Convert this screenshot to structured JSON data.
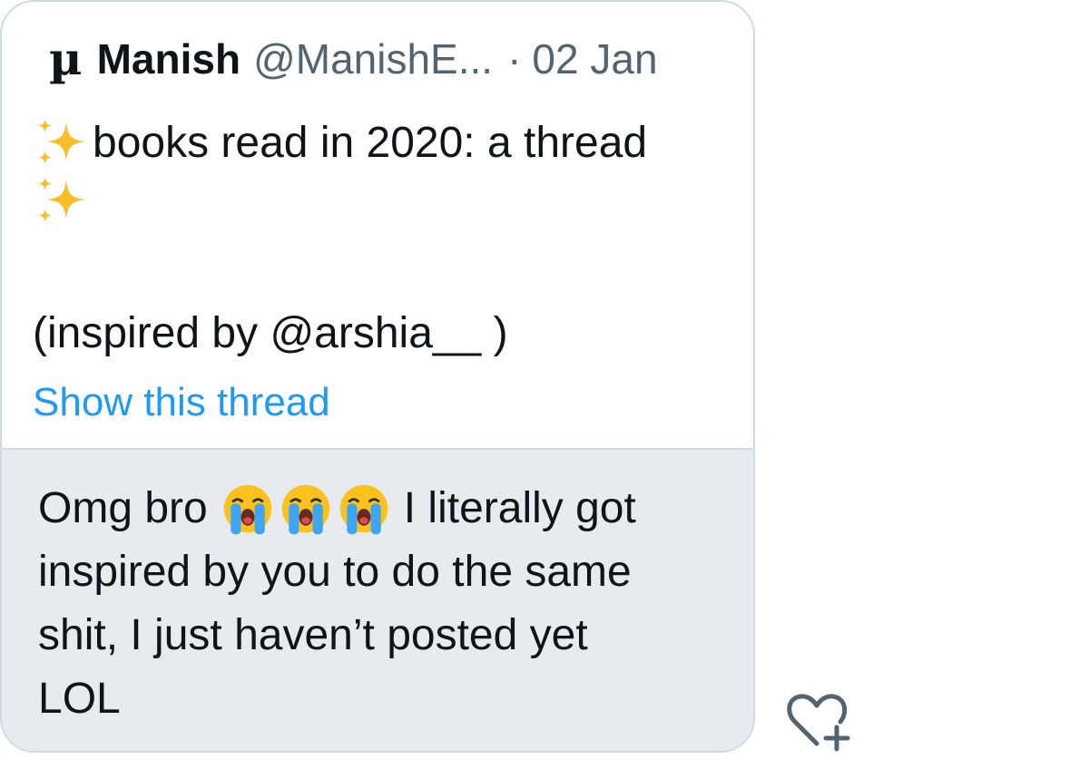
{
  "quoted_tweet": {
    "author_glyph": "µ",
    "author_name": "Manish",
    "author_handle": "@ManishE...",
    "separator": "·",
    "date": "02 Jan",
    "text_line_1": "books read in 2020: a thread",
    "text_inspired": "(inspired by @arshia__ )",
    "show_thread_label": "Show this thread",
    "emoji": "sparkles-emoji"
  },
  "reply": {
    "text_prefix": "Omg bro",
    "emoji": "loudly-crying-face-emoji",
    "emoji_count": 3,
    "text_line_1_rest": "I literally got",
    "text_line_2": "inspired by you to do the same",
    "text_line_3": "shit, I just haven’t posted yet",
    "text_line_4": "LOL"
  },
  "actions": {
    "react_icon": "heart-plus-icon"
  },
  "colors": {
    "text": "#0f1419",
    "muted": "#536471",
    "link": "#1d9bf0",
    "border": "#cfd9de",
    "reply_bg": "#e7ebef"
  }
}
